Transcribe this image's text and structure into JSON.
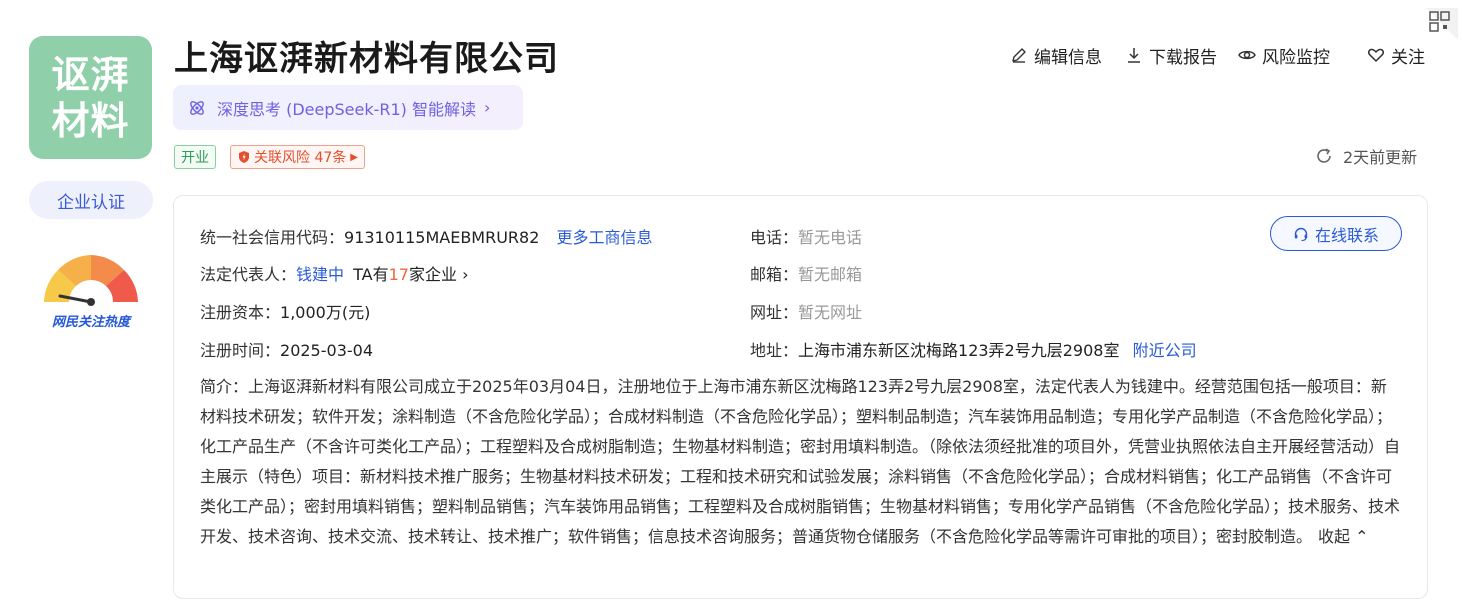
{
  "logo": {
    "line1": "讴湃",
    "line2": "材料",
    "bg": "#8fcfa9"
  },
  "cert_label": "企业认证",
  "heat_label": "网民关注热度",
  "company": {
    "name": "上海讴湃新材料有限公司",
    "ai_label": "深度思考 (DeepSeek-R1) 智能解读",
    "ai_chevron": "›"
  },
  "tags": {
    "status": "开业",
    "risk": "关联风险 47条"
  },
  "actions": {
    "edit": "编辑信息",
    "download": "下载报告",
    "monitor": "风险监控",
    "follow": "关注"
  },
  "updated": "2天前更新",
  "info": {
    "credit_code_label": "统一社会信用代码：",
    "credit_code": "91310115MAEBMRUR82",
    "more_link": "更多工商信息",
    "legal_label": "法定代表人：",
    "legal_name": "钱建中",
    "ta_prefix": "TA有",
    "ta_count": "17",
    "ta_suffix": "家企业",
    "capital_label": "注册资本：",
    "capital": "1,000万(元)",
    "reg_time_label": "注册时间：",
    "reg_time": "2025-03-04",
    "phone_label": "电话：",
    "phone": "暂无电话",
    "email_label": "邮箱：",
    "email": "暂无邮箱",
    "website_label": "网址：",
    "website": "暂无网址",
    "address_label": "地址：",
    "address": "上海市浦东新区沈梅路123弄2号九层2908室",
    "nearby_link": "附近公司",
    "contact_button": "在线联系"
  },
  "intro": {
    "text": "简介：上海讴湃新材料有限公司成立于2025年03月04日，注册地位于上海市浦东新区沈梅路123弄2号九层2908室，法定代表人为钱建中。经营范围包括一般项目：新材料技术研发；软件开发；涂料制造（不含危险化学品）；合成材料制造（不含危险化学品）；塑料制品制造；汽车装饰用品制造；专用化学产品制造（不含危险化学品）；化工产品生产（不含许可类化工产品）；工程塑料及合成树脂制造；生物基材料制造；密封用填料制造。（除依法须经批准的项目外，凭营业执照依法自主开展经营活动）自主展示（特色）项目：新材料技术推广服务；生物基材料技术研发；工程和技术研究和试验发展；涂料销售（不含危险化学品）；合成材料销售；化工产品销售（不含许可类化工产品）；密封用填料销售；塑料制品销售；汽车装饰用品销售；工程塑料及合成树脂销售；生物基材料销售；专用化学产品销售（不含危险化学品）；技术服务、技术开发、技术咨询、技术交流、技术转让、技术推广；软件销售；信息技术咨询服务；普通货物仓储服务（不含危险化学品等需许可审批的项目）；密封胶制造。",
    "collapse": "收起 ⌃"
  },
  "colors": {
    "link": "#2a5bd7",
    "accent_orange": "#f0663c",
    "ai_purple": "#6f61e0"
  }
}
